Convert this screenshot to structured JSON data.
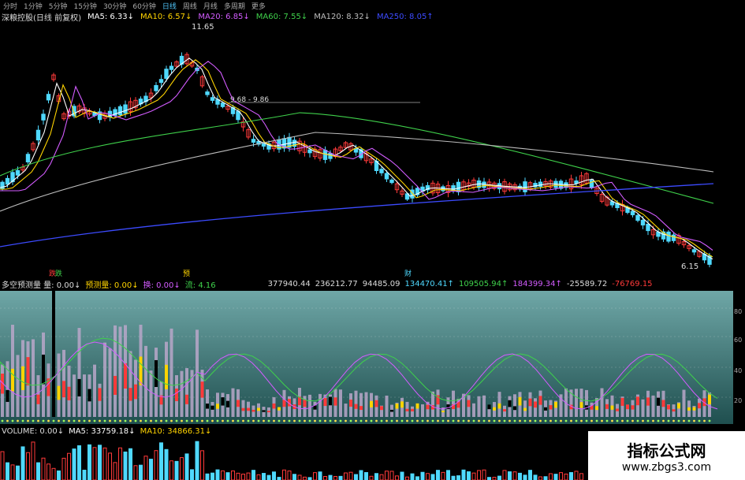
{
  "toolbar": {
    "items": [
      "分时",
      "1分钟",
      "5分钟",
      "15分钟",
      "30分钟",
      "60分钟",
      "日线",
      "周线",
      "月线",
      "多周期",
      "更多"
    ],
    "active": "日线"
  },
  "price_header": {
    "title": "深粮控股(日线 前复权)",
    "ma5": "MA5: 6.33↓",
    "ma10": "MA10: 6.57↓",
    "ma20": "MA20: 6.85↓",
    "ma60": "MA60: 7.55↓",
    "ma120": "MA120: 8.32↓",
    "ma250": "MA250: 8.05↑"
  },
  "price_annotations": {
    "high": "11.65",
    "range": "9.68 - 9.86",
    "low": "6.15"
  },
  "indicator_header": {
    "name": "多空预测量 量: 0.00↓",
    "pred": "预测量: 0.00↓",
    "huan": "换: 0.00↓",
    "liu": "流: 4.16",
    "v1": "377940.44",
    "v2": "236212.77",
    "v3": "94485.09",
    "v4": "134470.41↑",
    "v5": "109505.94↑",
    "v6": "184399.34↑",
    "v7": "-25589.72",
    "v8": "-76769.15"
  },
  "indicator_marks": {
    "m1": "跌",
    "m2": "跌",
    "m3": "预",
    "m4": "财"
  },
  "volume_header": {
    "name": "VOLUME: 0.00↓",
    "ma5": "MA5: 33759.18↓",
    "ma10": "MA10: 34866.31↓"
  },
  "right_axis": [
    "80",
    "60",
    "40",
    "20"
  ],
  "watermark": {
    "title": "指标公式网",
    "url": "www.zbgs3.com"
  },
  "colors": {
    "ma5": "#ffffff",
    "ma10": "#ffd400",
    "ma20": "#d35cff",
    "ma60": "#3fd14b",
    "ma120": "#bdbdbd",
    "ma250": "#3c4bff",
    "up": "#ff3a3a",
    "down": "#4fd9ff"
  }
}
